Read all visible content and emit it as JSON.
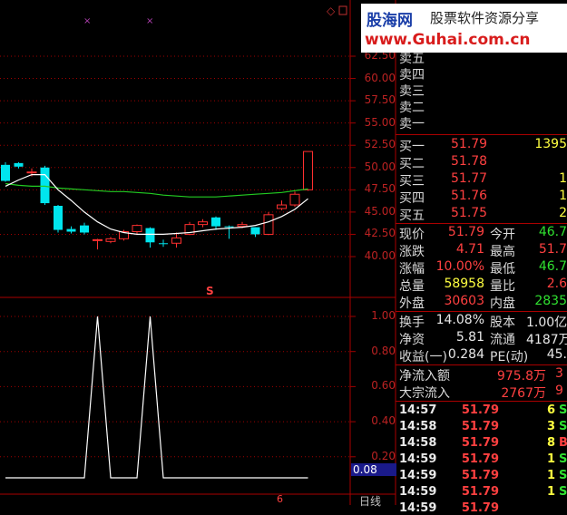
{
  "brand": {
    "name": "股海网",
    "slogan": "股票软件资源分享",
    "url": "www.Guhai.com.cn"
  },
  "price_axis": [
    "62.50",
    "60.00",
    "57.50",
    "55.00",
    "52.50",
    "50.00",
    "47.50",
    "45.00",
    "42.50",
    "40.00"
  ],
  "indicator_axis": [
    "1.00",
    "0.80",
    "0.60",
    "0.40",
    "0.20"
  ],
  "indicator_value": "0.08",
  "marker_s": "S",
  "x_marker": "6",
  "period_label": "日线",
  "order_book": {
    "sells": [
      {
        "label": "卖五"
      },
      {
        "label": "卖四"
      },
      {
        "label": "卖三"
      },
      {
        "label": "卖二"
      },
      {
        "label": "卖一"
      }
    ],
    "buys": [
      {
        "label": "买一",
        "price": "51.79",
        "vol": "1395"
      },
      {
        "label": "买二",
        "price": "51.78",
        "vol": ""
      },
      {
        "label": "买三",
        "price": "51.77",
        "vol": "1"
      },
      {
        "label": "买四",
        "price": "51.76",
        "vol": "1"
      },
      {
        "label": "买五",
        "price": "51.75",
        "vol": "2"
      }
    ]
  },
  "quote": {
    "rows": [
      {
        "l1": "现价",
        "v1": "51.79",
        "l2": "今开",
        "v2": "46.7"
      },
      {
        "l1": "涨跌",
        "v1": "4.71",
        "l2": "最高",
        "v2": "51.7"
      },
      {
        "l1": "涨幅",
        "v1": "10.00%",
        "l2": "最低",
        "v2": "46.7"
      },
      {
        "l1": "总量",
        "v1": "58958",
        "l2": "量比",
        "v2": "2.6"
      },
      {
        "l1": "外盘",
        "v1": "30603",
        "l2": "内盘",
        "v2": "2835"
      }
    ]
  },
  "fundamentals": {
    "rows": [
      {
        "l1": "换手",
        "v1": "14.08%",
        "l2": "股本",
        "v2": "1.00亿"
      },
      {
        "l1": "净资",
        "v1": "5.81",
        "l2": "流通",
        "v2": "4187万"
      },
      {
        "l1": "收益(一)",
        "v1": "0.284",
        "l2": "PE(动)",
        "v2": "45."
      }
    ]
  },
  "flows": {
    "rows": [
      {
        "label": "净流入额",
        "value": "975.8万",
        "extra": "3"
      },
      {
        "label": "大宗流入",
        "value": "2767万",
        "extra": "9"
      }
    ]
  },
  "trades": [
    {
      "time": "14:57",
      "price": "51.79",
      "vol": "6",
      "flag": "S"
    },
    {
      "time": "14:58",
      "price": "51.79",
      "vol": "3",
      "flag": "S"
    },
    {
      "time": "14:58",
      "price": "51.79",
      "vol": "8",
      "flag": "B"
    },
    {
      "time": "14:59",
      "price": "51.79",
      "vol": "1",
      "flag": "S"
    },
    {
      "time": "14:59",
      "price": "51.79",
      "vol": "1",
      "flag": "S"
    },
    {
      "time": "14:59",
      "price": "51.79",
      "vol": "1",
      "flag": "S"
    },
    {
      "time": "14:59",
      "price": "51.79",
      "vol": "",
      "flag": ""
    }
  ],
  "chart_data": {
    "type": "candlestick",
    "price_axis_range": [
      38.75,
      63.75
    ],
    "candles": [
      {
        "o": 50.3,
        "h": 50.6,
        "c": 48.5,
        "l": 48.4
      },
      {
        "o": 50.5,
        "h": 50.6,
        "c": 50.1,
        "l": 49.9
      },
      {
        "o": 49.5,
        "h": 49.9,
        "c": 49.5,
        "l": 49.0
      },
      {
        "o": 50.0,
        "h": 50.2,
        "c": 46.0,
        "l": 45.8
      },
      {
        "o": 45.7,
        "h": 45.8,
        "c": 43.0,
        "l": 42.7
      },
      {
        "o": 43.1,
        "h": 43.4,
        "c": 42.8,
        "l": 42.6
      },
      {
        "o": 43.5,
        "h": 43.8,
        "c": 42.7,
        "l": 42.5
      },
      {
        "o": 41.9,
        "h": 42.0,
        "c": 41.9,
        "l": 40.8
      },
      {
        "o": 41.7,
        "h": 42.2,
        "c": 42.0,
        "l": 41.5
      },
      {
        "o": 42.0,
        "h": 43.0,
        "c": 42.8,
        "l": 41.8
      },
      {
        "o": 42.8,
        "h": 43.6,
        "c": 43.5,
        "l": 42.5
      },
      {
        "o": 43.2,
        "h": 43.3,
        "c": 41.6,
        "l": 41.0
      },
      {
        "o": 41.5,
        "h": 41.9,
        "c": 41.4,
        "l": 41.1
      },
      {
        "o": 41.5,
        "h": 42.7,
        "c": 42.1,
        "l": 41.0
      },
      {
        "o": 42.5,
        "h": 43.9,
        "c": 43.6,
        "l": 42.4
      },
      {
        "o": 43.6,
        "h": 44.2,
        "c": 43.9,
        "l": 43.3
      },
      {
        "o": 44.4,
        "h": 44.5,
        "c": 43.4,
        "l": 43.0
      },
      {
        "o": 43.4,
        "h": 43.5,
        "c": 43.3,
        "l": 42.0
      },
      {
        "o": 43.4,
        "h": 43.9,
        "c": 43.6,
        "l": 43.2
      },
      {
        "o": 43.3,
        "h": 43.3,
        "c": 42.5,
        "l": 42.2
      },
      {
        "o": 42.5,
        "h": 45.0,
        "c": 44.7,
        "l": 42.4
      },
      {
        "o": 45.4,
        "h": 46.3,
        "c": 45.8,
        "l": 45.2
      },
      {
        "o": 45.8,
        "h": 47.3,
        "c": 47.0,
        "l": 45.6
      },
      {
        "o": 47.5,
        "h": 51.8,
        "c": 51.8,
        "l": 47.4
      }
    ],
    "ma_white": [
      47.9,
      48.6,
      49.2,
      49.2,
      47.5,
      46.3,
      45.0,
      43.9,
      43.1,
      42.7,
      42.5,
      42.5,
      42.5,
      42.6,
      42.7,
      42.9,
      43.1,
      43.2,
      43.3,
      43.5,
      43.9,
      44.5,
      45.3,
      46.5
    ],
    "ma_green": [
      48.2,
      48.0,
      47.9,
      47.9,
      47.7,
      47.6,
      47.5,
      47.4,
      47.3,
      47.3,
      47.2,
      47.1,
      46.9,
      46.8,
      46.7,
      46.7,
      46.7,
      46.8,
      46.9,
      47.0,
      47.1,
      47.2,
      47.4,
      47.6
    ],
    "indicator": [
      0.08,
      0.08,
      0.08,
      0.08,
      0.08,
      0.08,
      0.08,
      1.0,
      0.08,
      0.08,
      0.08,
      1.0,
      0.08,
      0.08,
      0.08,
      0.08,
      0.08,
      0.08,
      0.08,
      0.08,
      0.08,
      0.08,
      0.08,
      0.08
    ],
    "indicator_range": [
      0,
      1.05
    ]
  },
  "colors": {
    "up": "#ff3030",
    "down": "#00e5ee",
    "ma1": "#ffffff",
    "ma2": "#22cc22",
    "grid": "#a00000"
  }
}
